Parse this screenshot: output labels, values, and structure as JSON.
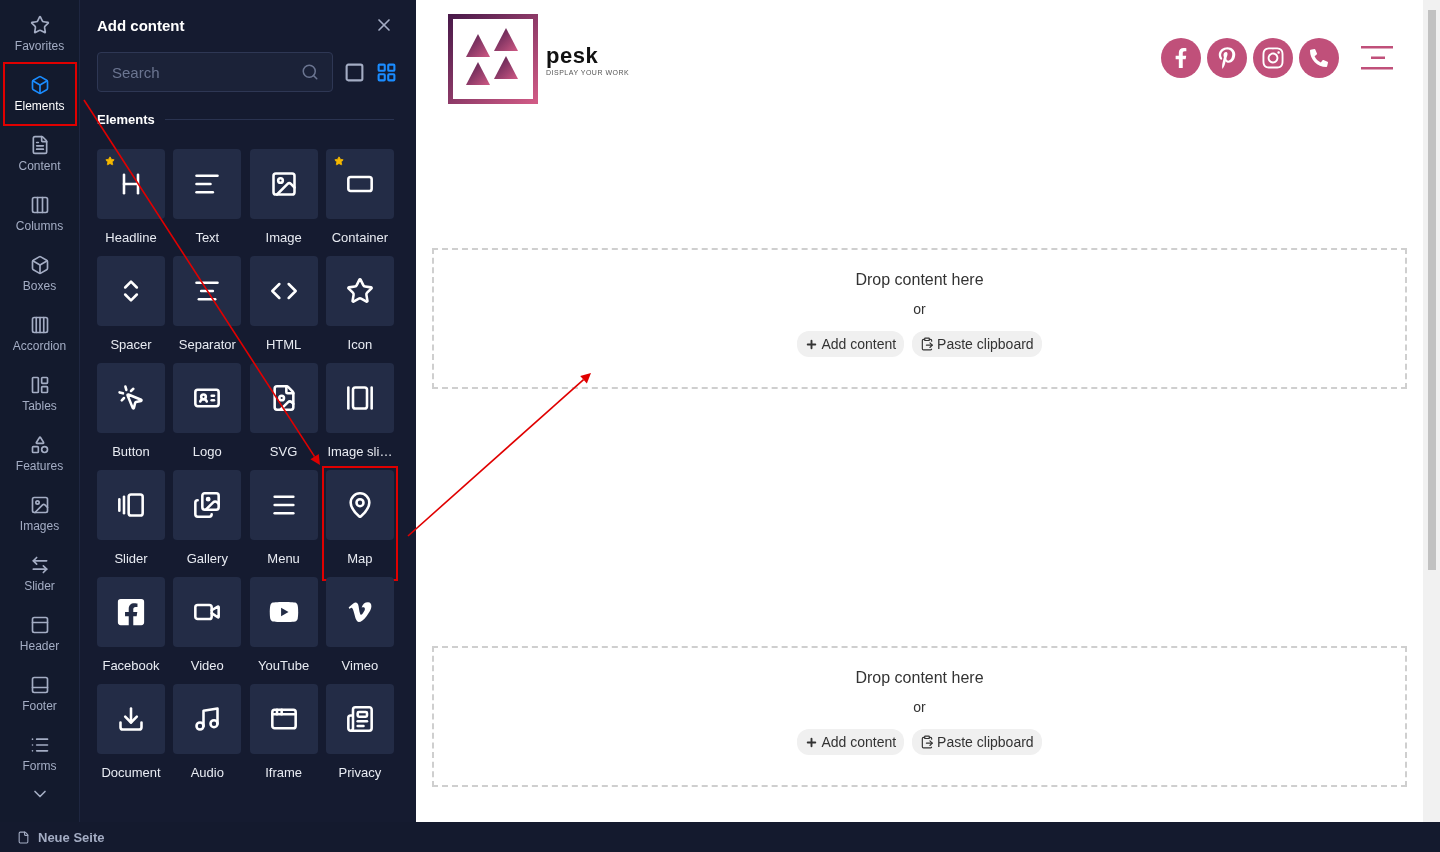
{
  "sidebar": {
    "items": [
      {
        "label": "Favorites",
        "selected": false,
        "highlighted": false
      },
      {
        "label": "Elements",
        "selected": true,
        "highlighted": true
      },
      {
        "label": "Content",
        "selected": false,
        "highlighted": false
      },
      {
        "label": "Columns",
        "selected": false,
        "highlighted": false
      },
      {
        "label": "Boxes",
        "selected": false,
        "highlighted": false
      },
      {
        "label": "Accordion",
        "selected": false,
        "highlighted": false
      },
      {
        "label": "Tables",
        "selected": false,
        "highlighted": false
      },
      {
        "label": "Features",
        "selected": false,
        "highlighted": false
      },
      {
        "label": "Images",
        "selected": false,
        "highlighted": false
      },
      {
        "label": "Slider",
        "selected": false,
        "highlighted": false
      },
      {
        "label": "Header",
        "selected": false,
        "highlighted": false
      },
      {
        "label": "Footer",
        "selected": false,
        "highlighted": false
      },
      {
        "label": "Forms",
        "selected": false,
        "highlighted": false
      }
    ]
  },
  "panel": {
    "title": "Add content",
    "search": {
      "placeholder": "Search"
    },
    "view": {
      "grid_selected": true
    },
    "section": "Elements",
    "elements": [
      {
        "label": "Headline",
        "favorite": true,
        "highlighted": false
      },
      {
        "label": "Text",
        "favorite": false,
        "highlighted": false
      },
      {
        "label": "Image",
        "favorite": false,
        "highlighted": false
      },
      {
        "label": "Container",
        "favorite": true,
        "highlighted": false
      },
      {
        "label": "Spacer",
        "favorite": false,
        "highlighted": false
      },
      {
        "label": "Separator",
        "favorite": false,
        "highlighted": false
      },
      {
        "label": "HTML",
        "favorite": false,
        "highlighted": false
      },
      {
        "label": "Icon",
        "favorite": false,
        "highlighted": false
      },
      {
        "label": "Button",
        "favorite": false,
        "highlighted": false
      },
      {
        "label": "Logo",
        "favorite": false,
        "highlighted": false
      },
      {
        "label": "SVG",
        "favorite": false,
        "highlighted": false
      },
      {
        "label": "Image sli…",
        "favorite": false,
        "highlighted": false
      },
      {
        "label": "Slider",
        "favorite": false,
        "highlighted": false
      },
      {
        "label": "Gallery",
        "favorite": false,
        "highlighted": false
      },
      {
        "label": "Menu",
        "favorite": false,
        "highlighted": false
      },
      {
        "label": "Map",
        "favorite": false,
        "highlighted": true
      },
      {
        "label": "Facebook",
        "favorite": false,
        "highlighted": false
      },
      {
        "label": "Video",
        "favorite": false,
        "highlighted": false
      },
      {
        "label": "YouTube",
        "favorite": false,
        "highlighted": false
      },
      {
        "label": "Vimeo",
        "favorite": false,
        "highlighted": false
      },
      {
        "label": "Document",
        "favorite": false,
        "highlighted": false
      },
      {
        "label": "Audio",
        "favorite": false,
        "highlighted": false
      },
      {
        "label": "Iframe",
        "favorite": false,
        "highlighted": false
      },
      {
        "label": "Privacy",
        "favorite": false,
        "highlighted": false
      }
    ]
  },
  "canvas": {
    "logo": {
      "name": "pesk",
      "tagline": "DISPLAY YOUR WORK"
    },
    "dropzones": [
      {
        "title": "Drop content here",
        "or": "or",
        "add": "Add content",
        "paste": "Paste clipboard"
      },
      {
        "title": "Drop content here",
        "or": "or",
        "add": "Add content",
        "paste": "Paste clipboard"
      }
    ]
  },
  "status_bar": {
    "page": "Neue Seite"
  }
}
